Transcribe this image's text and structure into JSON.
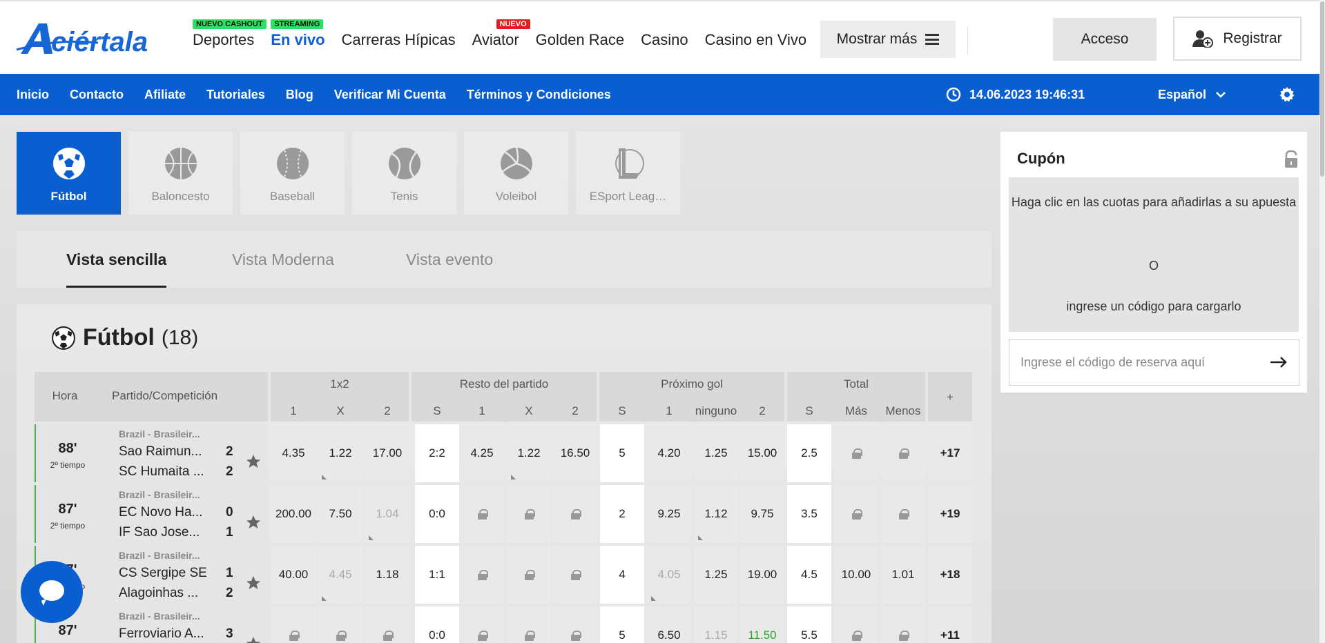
{
  "header": {
    "logo_text": "Aciértala",
    "nav": [
      {
        "label": "Deportes",
        "badge": "NUEVO CASHOUT",
        "active": false
      },
      {
        "label": "En vivo",
        "badge": "STREAMING",
        "active": true
      },
      {
        "label": "Carreras Hípicas",
        "badge": "",
        "active": false
      },
      {
        "label": "Aviator",
        "badge": "NUEVO",
        "active": false
      },
      {
        "label": "Golden Race",
        "badge": "",
        "active": false
      },
      {
        "label": "Casino",
        "badge": "",
        "active": false
      },
      {
        "label": "Casino en Vivo",
        "badge": "",
        "active": false
      }
    ],
    "more_label": "Mostrar más",
    "login_label": "Acceso",
    "register_label": "Registrar"
  },
  "subnav": {
    "items": [
      "Inicio",
      "Contacto",
      "Afiliate",
      "Tutoriales",
      "Blog",
      "Verificar Mi Cuenta",
      "Términos y Condiciones"
    ],
    "datetime": "14.06.2023 19:46:31",
    "language": "Español"
  },
  "sports": [
    {
      "label": "Fútbol",
      "icon": "soccer-ball-icon",
      "active": true
    },
    {
      "label": "Baloncesto",
      "icon": "basketball-icon",
      "active": false
    },
    {
      "label": "Baseball",
      "icon": "baseball-icon",
      "active": false
    },
    {
      "label": "Tenis",
      "icon": "tennis-ball-icon",
      "active": false
    },
    {
      "label": "Voleibol",
      "icon": "volleyball-icon",
      "active": false
    },
    {
      "label": "ESport Leag…",
      "icon": "esport-league-icon",
      "active": false
    }
  ],
  "view_tabs": [
    "Vista sencilla",
    "Vista Moderna",
    "Vista evento"
  ],
  "panel": {
    "title": "Fútbol",
    "count": "(18)"
  },
  "table": {
    "headers": {
      "time": "Hora",
      "match": "Partido/Competición",
      "groups": [
        "1x2",
        "Resto del partido",
        "Próximo gol",
        "Total"
      ],
      "plus": "+",
      "sub_1x2": [
        "1",
        "X",
        "2"
      ],
      "sub_rest": [
        "S",
        "1",
        "X",
        "2"
      ],
      "sub_next": [
        "S",
        "1",
        "ninguno",
        "2"
      ],
      "sub_total": [
        "S",
        "Más",
        "Menos"
      ]
    },
    "rows": [
      {
        "minute": "88'",
        "period": "2º tiempo",
        "competition": "Brazil - Brasileir...",
        "home": "Sao Raimun...",
        "away": "SC Humaita ...",
        "home_score": "2",
        "away_score": "2",
        "odds_1x2": [
          "4.35",
          "1.22",
          "17.00"
        ],
        "rest": [
          "2:2",
          "4.25",
          "1.22",
          "16.50"
        ],
        "next": [
          "5",
          "4.20",
          "1.25",
          "15.00"
        ],
        "total": [
          "2.5",
          "lock",
          "lock"
        ],
        "more": "+17"
      },
      {
        "minute": "87'",
        "period": "2º tiempo",
        "competition": "Brazil - Brasileir...",
        "home": "EC Novo Ha...",
        "away": "IF Sao Jose...",
        "home_score": "0",
        "away_score": "1",
        "odds_1x2": [
          "200.00",
          "7.50",
          "1.04"
        ],
        "rest": [
          "0:0",
          "lock",
          "lock",
          "lock"
        ],
        "next": [
          "2",
          "9.25",
          "1.12",
          "9.75"
        ],
        "total": [
          "3.5",
          "lock",
          "lock"
        ],
        "more": "+19"
      },
      {
        "minute": "87'",
        "period": "2º tiempo",
        "competition": "Brazil - Brasileir...",
        "home": "CS Sergipe SE",
        "away": "Alagoinhas ...",
        "home_score": "1",
        "away_score": "2",
        "odds_1x2": [
          "40.00",
          "4.45",
          "1.18"
        ],
        "rest": [
          "1:1",
          "lock",
          "lock",
          "lock"
        ],
        "next": [
          "4",
          "4.05",
          "1.25",
          "19.00"
        ],
        "total": [
          "4.5",
          "10.00",
          "1.01"
        ],
        "more": "+18"
      },
      {
        "minute": "87'",
        "period": "",
        "competition": "Brazil - Brasileir...",
        "home": "Ferroviario A...",
        "away": "",
        "home_score": "3",
        "away_score": "",
        "odds_1x2": [
          "lock",
          "lock",
          "lock"
        ],
        "rest": [
          "0:0",
          "lock",
          "lock",
          "lock"
        ],
        "next": [
          "5",
          "6.50",
          "1.15",
          "11.50"
        ],
        "total": [
          "5.5",
          "lock",
          "lock"
        ],
        "more": "+11"
      }
    ]
  },
  "coupon": {
    "title": "Cupón",
    "message_line1": "Haga clic en las cuotas para añadirlas a su apuesta",
    "message_or": "O",
    "message_line2": "ingrese un código para cargarlo",
    "input_placeholder": "Ingrese el código de reserva aquí"
  },
  "colors": {
    "brand_blue": "#0a5fd0",
    "badge_green": "#2ee060",
    "badge_red": "#e11d1d",
    "odds_up_green": "#2aa52a"
  }
}
